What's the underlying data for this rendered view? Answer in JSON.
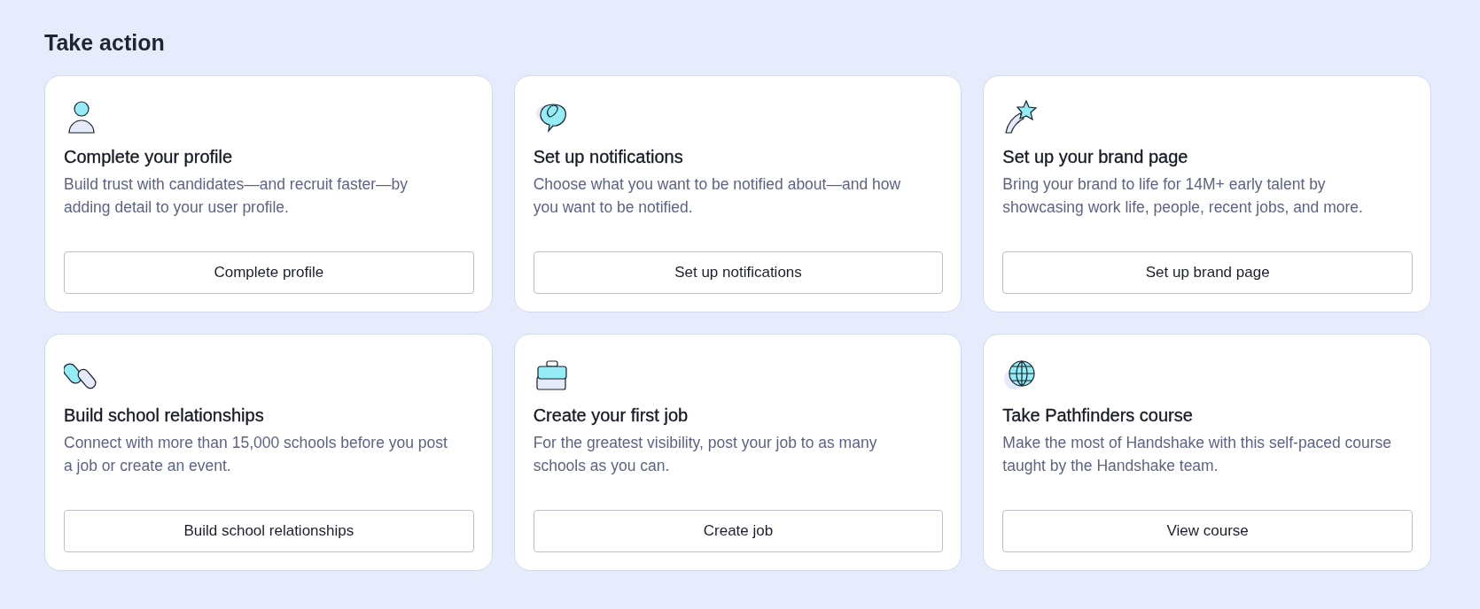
{
  "heading": "Take action",
  "cards": [
    {
      "title": "Complete your profile",
      "description": "Build trust with candidates—and recruit faster—by adding detail to your user profile.",
      "button": "Complete profile"
    },
    {
      "title": "Set up notifications",
      "description": "Choose what you want to be notified about—and how you want to be notified.",
      "button": "Set up notifications"
    },
    {
      "title": "Set up your brand page",
      "description": "Bring your brand to life for 14M+ early talent by showcasing work life, people, recent jobs, and more.",
      "button": "Set up brand page"
    },
    {
      "title": "Build school relationships",
      "description": "Connect with more than 15,000 schools before you post a job or create an event.",
      "button": "Build school relationships"
    },
    {
      "title": "Create your first job",
      "description": "For the greatest visibility, post your job to as many schools as you can.",
      "button": "Create job"
    },
    {
      "title": "Take Pathfinders course",
      "description": "Make the most of Handshake with this self-paced course taught by the Handshake team.",
      "button": "View course"
    }
  ]
}
